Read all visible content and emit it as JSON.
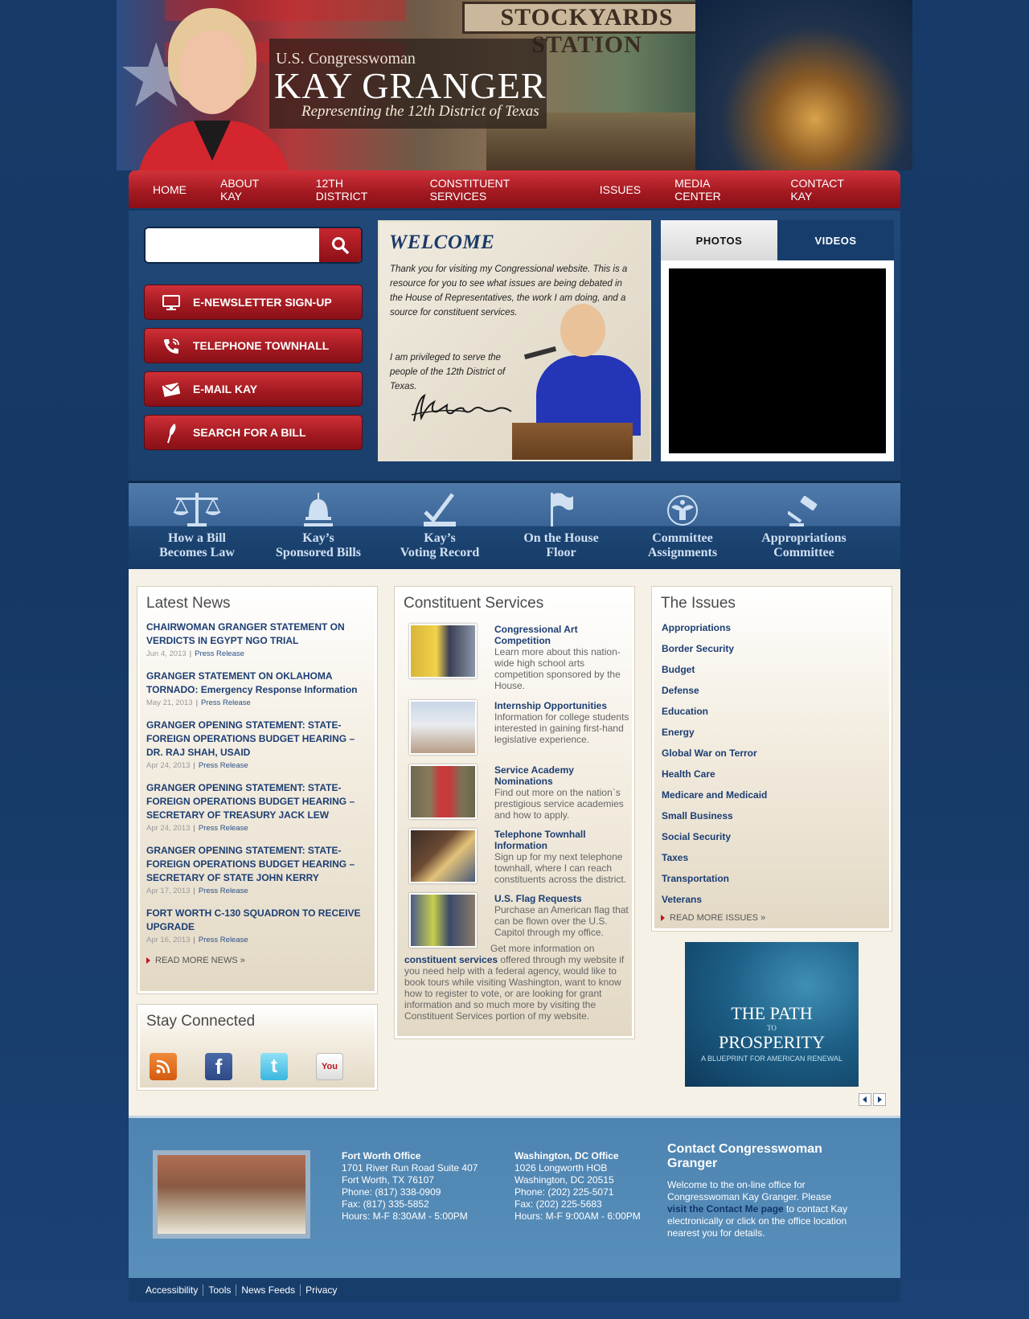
{
  "header": {
    "subtitle": "U.S. Congresswoman",
    "name": "KAY GRANGER",
    "tagline": "Representing the 12th District of Texas",
    "sign": "STOCKYARDS STATION"
  },
  "nav": [
    "HOME",
    "ABOUT KAY",
    "12TH DISTRICT",
    "CONSTITUENT SERVICES",
    "ISSUES",
    "MEDIA CENTER",
    "CONTACT KAY"
  ],
  "search": {
    "placeholder": ""
  },
  "side_buttons": [
    "E-NEWSLETTER SIGN-UP",
    "TELEPHONE TOWNHALL",
    "E-MAIL KAY",
    "SEARCH FOR A BILL"
  ],
  "welcome": {
    "title": "WELCOME",
    "text": "Thank you for visiting my Congressional website. This is a resource for you to see what issues are being debated in the House of Representatives, the work I am doing, and a source for constituent services.",
    "text2": "I am privileged to serve the people of the 12th District of Texas."
  },
  "media": {
    "tab_photos": "PHOTOS",
    "tab_videos": "VIDEOS"
  },
  "iconbar": [
    {
      "line1": "How a Bill",
      "line2": "Becomes Law",
      "icon": "scales-icon"
    },
    {
      "line1": "Kay’s",
      "line2": "Sponsored Bills",
      "icon": "capitol-icon"
    },
    {
      "line1": "Kay’s",
      "line2": "Voting Record",
      "icon": "check-vote-icon"
    },
    {
      "line1": "On the House",
      "line2": "Floor",
      "icon": "flag-icon"
    },
    {
      "line1": "Committee",
      "line2": "Assignments",
      "icon": "eagle-seal-icon"
    },
    {
      "line1": "Appropriations",
      "line2": "Committee",
      "icon": "gavel-icon"
    }
  ],
  "latest_news": {
    "title": "Latest News",
    "items": [
      {
        "headline": "CHAIRWOMAN GRANGER STATEMENT ON VERDICTS IN EGYPT NGO TRIAL",
        "date": "Jun 4, 2013",
        "category": "Press Release"
      },
      {
        "headline": "GRANGER STATEMENT ON OKLAHOMA TORNADO: Emergency Response Information",
        "date": "May 21, 2013",
        "category": "Press Release"
      },
      {
        "headline": "GRANGER OPENING STATEMENT: STATE-FOREIGN OPERATIONS BUDGET HEARING – DR. RAJ SHAH, USAID",
        "date": "Apr 24, 2013",
        "category": "Press Release"
      },
      {
        "headline": "GRANGER OPENING STATEMENT: STATE-FOREIGN OPERATIONS BUDGET HEARING – SECRETARY OF TREASURY JACK LEW",
        "date": "Apr 24, 2013",
        "category": "Press Release"
      },
      {
        "headline": "GRANGER OPENING STATEMENT: STATE-FOREIGN OPERATIONS BUDGET HEARING – SECRETARY OF STATE JOHN KERRY",
        "date": "Apr 17, 2013",
        "category": "Press Release"
      },
      {
        "headline": "FORT WORTH C-130 SQUADRON TO RECEIVE UPGRADE",
        "date": "Apr 16, 2013",
        "category": "Press Release"
      }
    ],
    "read_more": "READ MORE NEWS »"
  },
  "stay_connected": {
    "title": "Stay Connected"
  },
  "constituent_services": {
    "title": "Constituent Services",
    "items": [
      {
        "title": "Congressional Art Competition",
        "desc": "Learn more about this nation-wide high school arts competition sponsored by the House."
      },
      {
        "title": "Internship Opportunities",
        "desc": "Information for college students interested in gaining first-hand legislative experience."
      },
      {
        "title": "Service Academy Nominations",
        "desc": "Find out more on the nation`s prestigious service academies and how to apply."
      },
      {
        "title": "Telephone Townhall Information",
        "desc": "Sign up for my next telephone townhall, where I can reach constituents across the district."
      },
      {
        "title": "U.S. Flag Requests",
        "desc": "Purchase an American flag that can be flown over the U.S. Capitol through my office."
      }
    ],
    "outro_prefix": "Get more information on",
    "outro_link": "constituent services",
    "outro_rest": "offered through my website if you need help with a federal agency, would like to book tours while visiting Washington, want to know how to register to vote, or are looking for grant information and so much more by visiting the Constituent Services portion of my website."
  },
  "issues": {
    "title": "The Issues",
    "items": [
      "Appropriations",
      "Border Security",
      "Budget",
      "Defense",
      "Education",
      "Energy",
      "Global War on Terror",
      "Health Care",
      "Medicare and Medicaid",
      "Small Business",
      "Social Security",
      "Taxes",
      "Transportation",
      "Veterans"
    ],
    "read_more": "READ MORE ISSUES »"
  },
  "promo": {
    "line1": "THE PATH",
    "line2": "TO",
    "line3": "PROSPERITY",
    "line4": "A BLUEPRINT FOR AMERICAN RENEWAL"
  },
  "footer": {
    "fort_worth": {
      "title": "Fort Worth Office",
      "lines": [
        "1701 River Run Road Suite 407",
        "Fort Worth, TX 76107",
        "Phone: (817) 338-0909",
        "Fax: (817) 335-5852",
        "Hours: M-F 8:30AM - 5:00PM"
      ]
    },
    "dc": {
      "title": "Washington, DC Office",
      "lines": [
        "1026 Longworth HOB",
        "Washington, DC 20515",
        "Phone: (202) 225-5071",
        "Fax: (202) 225-5683",
        "Hours: M-F 9:00AM - 6:00PM"
      ]
    },
    "contact": {
      "title": "Contact Congresswoman Granger",
      "text_prefix": "Welcome to the on-line office for Congresswoman Kay Granger. Please",
      "link": "visit the Contact Me page",
      "text_suffix": "to contact Kay electronically or click on the office location nearest you for details."
    },
    "links": [
      "Accessibility",
      "Tools",
      "News Feeds",
      "Privacy"
    ]
  }
}
